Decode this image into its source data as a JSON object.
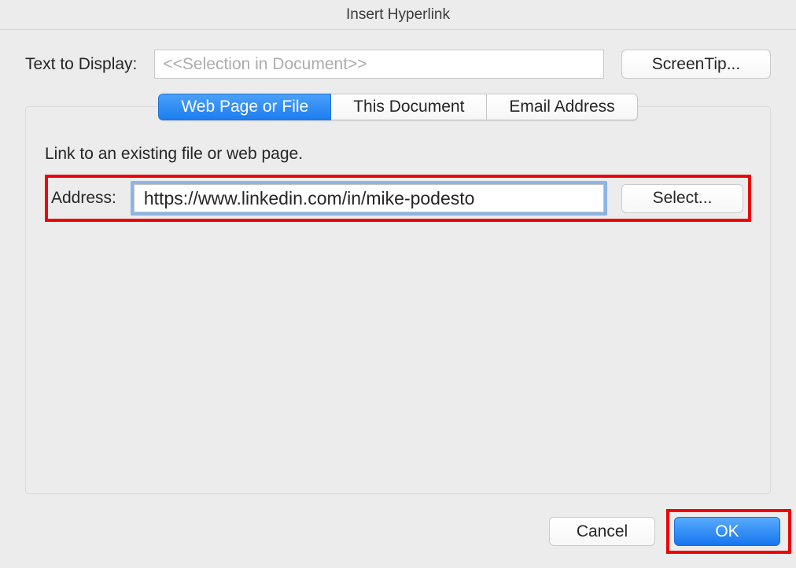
{
  "dialog": {
    "title": "Insert Hyperlink"
  },
  "textDisplay": {
    "label": "Text to Display:",
    "placeholder": "<<Selection in Document>>",
    "value": ""
  },
  "buttons": {
    "screentip": "ScreenTip...",
    "select": "Select...",
    "cancel": "Cancel",
    "ok": "OK"
  },
  "tabs": {
    "webPage": "Web Page or File",
    "thisDoc": "This Document",
    "email": "Email Address"
  },
  "panel": {
    "instruction": "Link to an existing file or web page.",
    "addressLabel": "Address:",
    "addressValue": "https://www.linkedin.com/in/mike-podesto"
  }
}
